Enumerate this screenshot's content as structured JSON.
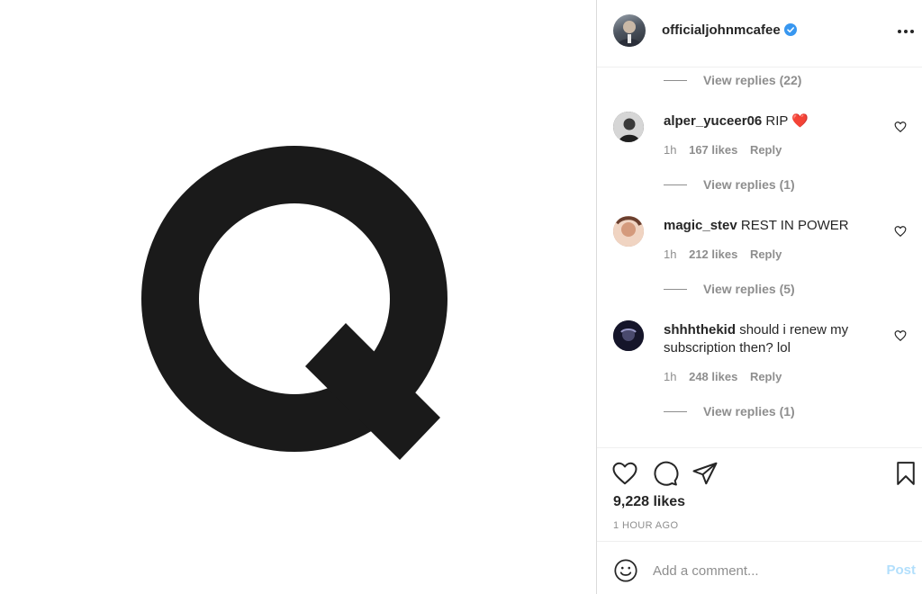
{
  "post": {
    "author": "officialjohnmcafee",
    "verified": true,
    "image_glyph": "Q"
  },
  "comments_section": {
    "top_view_replies": "View replies (22)",
    "comments": [
      {
        "username": "alper_yuceer06",
        "text": "RIP",
        "emoji": "❤️",
        "time": "1h",
        "likes": "167 likes",
        "reply_label": "Reply",
        "view_replies": "View replies (1)"
      },
      {
        "username": "magic_stev",
        "text": "REST IN POWER",
        "time": "1h",
        "likes": "212 likes",
        "reply_label": "Reply",
        "view_replies": "View replies (5)"
      },
      {
        "username": "shhhthekid",
        "text": "should i renew my subscription then? lol",
        "time": "1h",
        "likes": "248 likes",
        "reply_label": "Reply",
        "view_replies": "View replies (1)"
      }
    ]
  },
  "actions": {
    "likes_count": "9,228 likes",
    "time_ago": "1 HOUR AGO"
  },
  "add_comment": {
    "placeholder": "Add a comment...",
    "post_label": "Post"
  },
  "colors": {
    "verified_badge": "#3897f0",
    "post_button_disabled": "#b2dffc",
    "secondary_text": "#8e8e8e",
    "heart_emoji": "#ed4956"
  }
}
